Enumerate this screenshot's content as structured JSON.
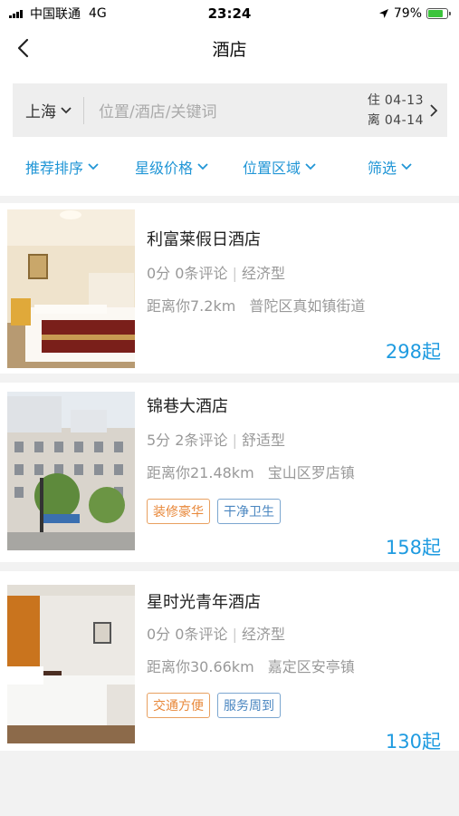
{
  "status": {
    "carrier": "中国联通",
    "network": "4G",
    "time": "23:24",
    "battery": "79%",
    "battery_level": 0.79
  },
  "nav": {
    "title": "酒店"
  },
  "search": {
    "city": "上海",
    "placeholder": "位置/酒店/关键词",
    "checkin_label": "住",
    "checkin": "04-13",
    "checkout_label": "离",
    "checkout": "04-14"
  },
  "filters": [
    "推荐排序",
    "星级价格",
    "位置区域",
    "筛选"
  ],
  "hotels": [
    {
      "name": "利富莱假日酒店",
      "score": "0分",
      "reviews": "0条评论",
      "type": "经济型",
      "distance": "距离你7.2km",
      "area": "普陀区真如镇街道",
      "tags": [],
      "price": "298起"
    },
    {
      "name": "锦巷大酒店",
      "score": "5分",
      "reviews": "2条评论",
      "type": "舒适型",
      "distance": "距离你21.48km",
      "area": "宝山区罗店镇",
      "tags": [
        "装修豪华",
        "干净卫生"
      ],
      "price": "158起"
    },
    {
      "name": "星时光青年酒店",
      "score": "0分",
      "reviews": "0条评论",
      "type": "经济型",
      "distance": "距离你30.66km",
      "area": "嘉定区安亭镇",
      "tags": [
        "交通方便",
        "服务周到"
      ],
      "price": "130起"
    }
  ],
  "colors": {
    "accent": "#1f9be0",
    "tag_orange": "#e8883a",
    "tag_blue": "#4a86c0"
  }
}
